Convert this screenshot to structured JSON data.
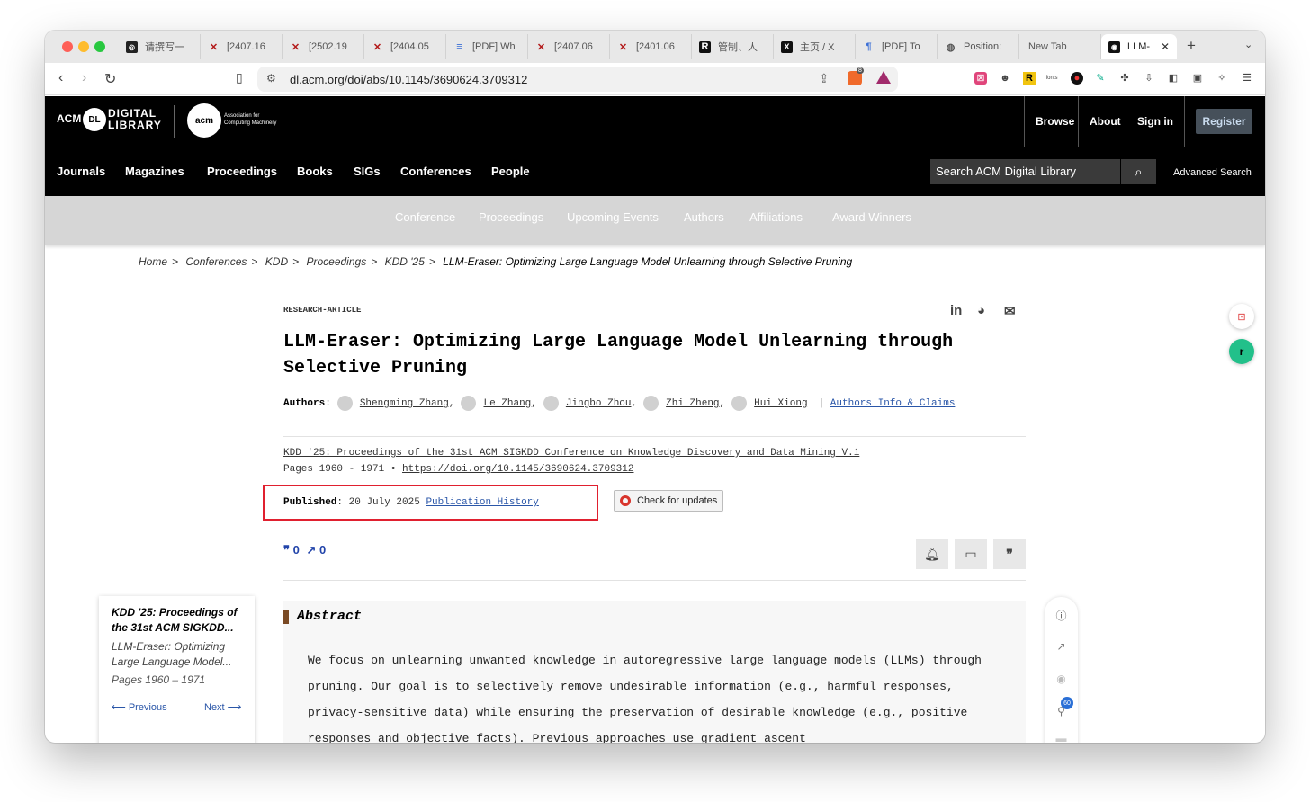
{
  "browser": {
    "tabs": [
      {
        "label": "请撰写一",
        "icon": "chatgpt-icon"
      },
      {
        "label": "[2407.16",
        "icon": "arxiv-x-icon"
      },
      {
        "label": "[2502.19",
        "icon": "arxiv-x-icon"
      },
      {
        "label": "[2404.05",
        "icon": "arxiv-x-icon"
      },
      {
        "label": "[PDF] Wh",
        "icon": "pdf-stack-icon"
      },
      {
        "label": "[2407.06",
        "icon": "arxiv-x-icon"
      },
      {
        "label": "[2401.06",
        "icon": "arxiv-x-icon"
      },
      {
        "label": "管制、人",
        "icon": "r-icon"
      },
      {
        "label": "主页 / X",
        "icon": "x-icon"
      },
      {
        "label": "[PDF] To",
        "icon": "paper-icon"
      },
      {
        "label": "Position:",
        "icon": "globe-icon"
      },
      {
        "label": "New Tab",
        "icon": ""
      }
    ],
    "active_tab": "LLM-",
    "url": "dl.acm.org/doi/abs/10.1145/3690624.3709312",
    "brave_badge": "8"
  },
  "header": {
    "acm": "ACM",
    "dl": "DL",
    "digital_library": "DIGITAL\nLIBRARY",
    "acm_circle": "acm",
    "assoc": "Association for\nComputing Machinery",
    "browse": "Browse",
    "about": "About",
    "signin": "Sign in",
    "register": "Register"
  },
  "nav": {
    "items": [
      "Journals",
      "Magazines",
      "Proceedings",
      "Books",
      "SIGs",
      "Conferences",
      "People"
    ],
    "search_placeholder": "Search ACM Digital Library",
    "advanced": "Advanced Search"
  },
  "subnav": [
    "Conference",
    "Proceedings",
    "Upcoming Events",
    "Authors",
    "Affiliations",
    "Award Winners"
  ],
  "breadcrumb": {
    "items": [
      "Home",
      "Conferences",
      "KDD",
      "Proceedings",
      "KDD '25"
    ],
    "current": "LLM-Eraser: Optimizing Large Language Model Unlearning through Selective Pruning"
  },
  "article": {
    "type": "RESEARCH-ARTICLE",
    "title": "LLM-Eraser: Optimizing Large Language Model Unlearning through Selective Pruning",
    "authors_label": "Authors",
    "authors": [
      "Shengming Zhang",
      "Le Zhang",
      "Jingbo Zhou",
      "Zhi Zheng",
      "Hui Xiong"
    ],
    "authors_info": "Authors Info & Claims",
    "proceedings": "KDD '25: Proceedings of the 31st ACM SIGKDD Conference on Knowledge Discovery and Data Mining V.1",
    "pages": "Pages 1960 - 1971",
    "doi": "https://doi.org/10.1145/3690624.3709312",
    "published_label": "Published",
    "published_date": "20 July 2025",
    "pub_history": "Publication History",
    "check_updates": "Check for updates",
    "citations": "0",
    "downloads": "0"
  },
  "abstract": {
    "heading": "Abstract",
    "text": "We focus on unlearning unwanted knowledge in autoregressive large language models (LLMs) through pruning. Our goal is to selectively remove undesirable information (e.g., harmful responses, privacy-sensitive data) while ensuring the preservation of desirable knowledge (e.g., positive responses and objective facts). Previous approaches use gradient ascent"
  },
  "side_card": {
    "title": "KDD '25: Proceedings of the 31st ACM SIGKDD...",
    "subtitle": "LLM-Eraser: Optimizing Large Language Model...",
    "pages": "Pages 1960 – 1971",
    "prev": "Previous",
    "next": "Next"
  },
  "rail": {
    "badge": "60"
  }
}
